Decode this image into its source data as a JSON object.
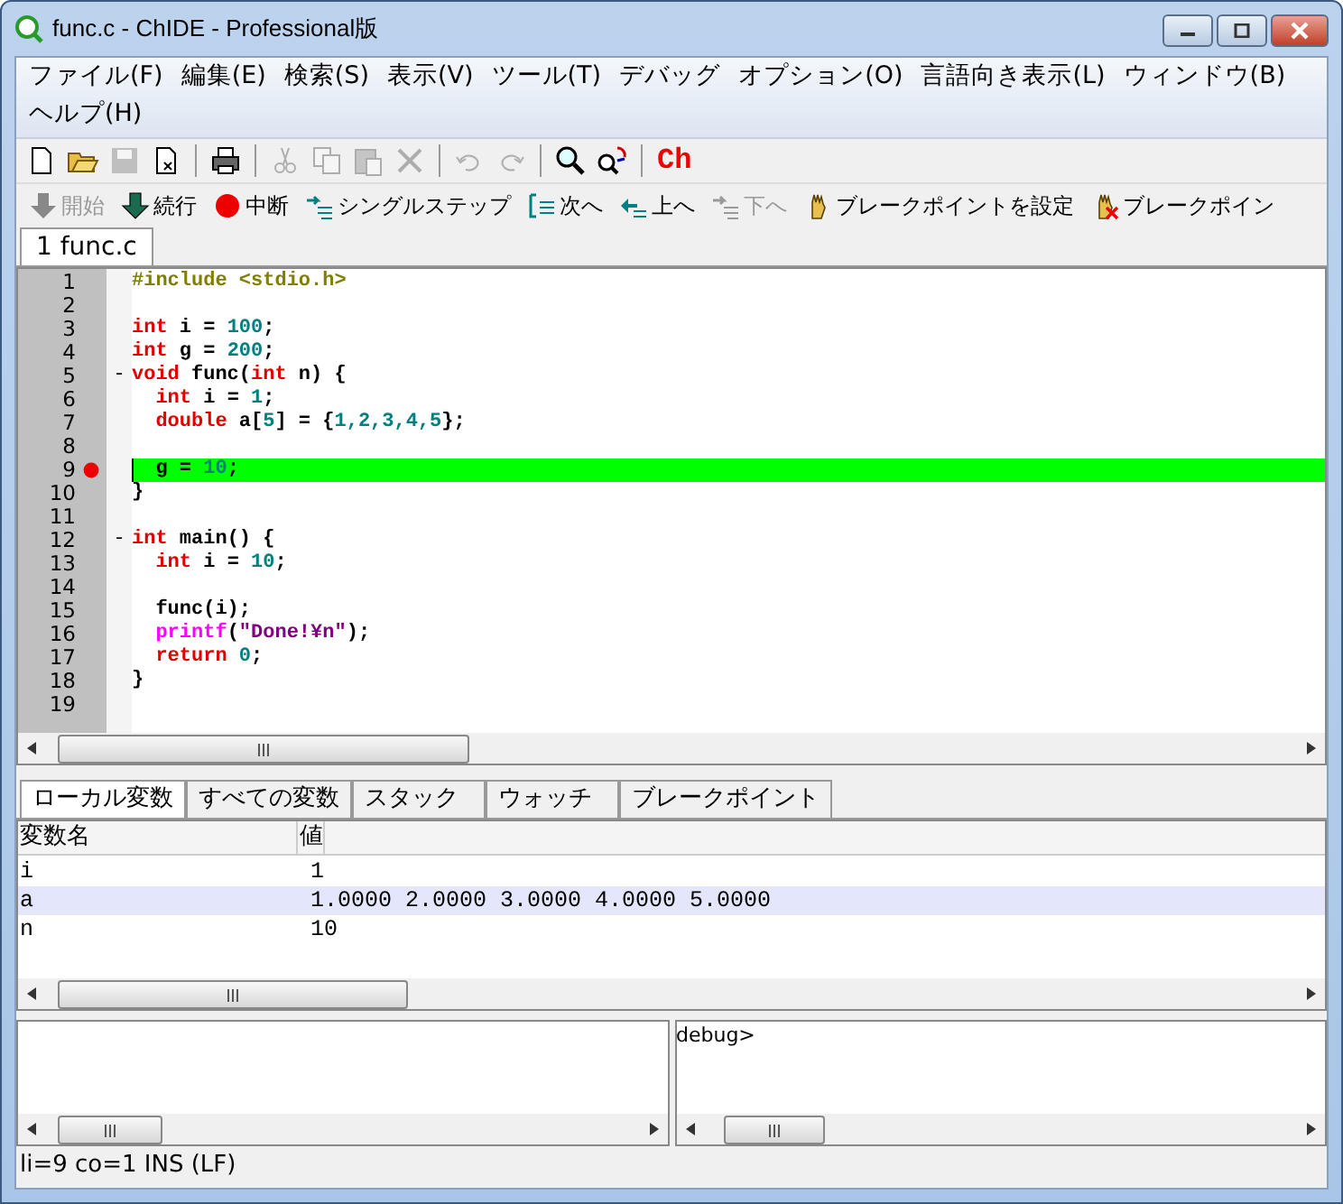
{
  "window": {
    "title": "func.c - ChIDE - Professional版"
  },
  "menu": [
    {
      "label": "ファイル(F)"
    },
    {
      "label": "編集(E)"
    },
    {
      "label": "検索(S)"
    },
    {
      "label": "表示(V)"
    },
    {
      "label": "ツール(T)"
    },
    {
      "label": "デバッグ"
    },
    {
      "label": "オプション(O)"
    },
    {
      "label": "言語向き表示(L)"
    },
    {
      "label": "ウィンドウ(B)"
    },
    {
      "label": "ヘルプ(H)"
    }
  ],
  "toolbar": [
    {
      "kind": "new",
      "disabled": false
    },
    {
      "kind": "open",
      "disabled": false
    },
    {
      "kind": "save",
      "disabled": true
    },
    {
      "kind": "close",
      "disabled": false
    },
    {
      "kind": "separator"
    },
    {
      "kind": "print",
      "disabled": false
    },
    {
      "kind": "separator"
    },
    {
      "kind": "cut",
      "disabled": true
    },
    {
      "kind": "copy",
      "disabled": true
    },
    {
      "kind": "paste",
      "disabled": true
    },
    {
      "kind": "delete",
      "disabled": true
    },
    {
      "kind": "separator"
    },
    {
      "kind": "undo",
      "disabled": true
    },
    {
      "kind": "redo",
      "disabled": true
    },
    {
      "kind": "separator"
    },
    {
      "kind": "find",
      "disabled": false
    },
    {
      "kind": "replace",
      "disabled": false
    },
    {
      "kind": "separator"
    },
    {
      "kind": "ch",
      "label": "Ch",
      "disabled": false
    }
  ],
  "debug_toolbar": [
    {
      "kind": "start",
      "label": "開始",
      "disabled": true
    },
    {
      "kind": "continue",
      "label": "続行",
      "disabled": false
    },
    {
      "kind": "break",
      "label": "中断",
      "disabled": false
    },
    {
      "kind": "step",
      "label": "シングルステップ",
      "disabled": false
    },
    {
      "kind": "next",
      "label": "次へ",
      "disabled": false
    },
    {
      "kind": "up",
      "label": "上へ",
      "disabled": false
    },
    {
      "kind": "down",
      "label": "下へ",
      "disabled": true
    },
    {
      "kind": "set_bp",
      "label": "ブレークポイントを設定",
      "disabled": false
    },
    {
      "kind": "clear_bp",
      "label": "ブレークポイン",
      "disabled": false
    }
  ],
  "file_tabs": [
    {
      "label": "1 func.c",
      "selected": true
    }
  ],
  "editor": {
    "lines": [
      {
        "number": "1",
        "breakpoint": false,
        "current": false,
        "tokens": [
          {
            "t": "#include <stdio.h>",
            "kind": "pre"
          }
        ]
      },
      {
        "number": "2",
        "breakpoint": false,
        "current": false
      },
      {
        "number": "3",
        "breakpoint": false,
        "current": false,
        "tokens": [
          {
            "t": "int",
            "kind": "kw"
          },
          {
            "t": " i = ",
            "kind": "id"
          },
          {
            "t": "100",
            "kind": "num"
          },
          {
            "t": ";",
            "kind": "id"
          }
        ]
      },
      {
        "number": "4",
        "breakpoint": false,
        "current": false,
        "tokens": [
          {
            "t": "int",
            "kind": "kw"
          },
          {
            "t": " g = ",
            "kind": "id"
          },
          {
            "t": "200",
            "kind": "num"
          },
          {
            "t": ";",
            "kind": "id"
          }
        ]
      },
      {
        "number": "5",
        "fold": "-",
        "breakpoint": false,
        "current": false,
        "tokens": [
          {
            "t": "void",
            "kind": "kw"
          },
          {
            "t": " func(",
            "kind": "id"
          },
          {
            "t": "int",
            "kind": "kw"
          },
          {
            "t": " n) {",
            "kind": "id"
          }
        ]
      },
      {
        "number": "6",
        "breakpoint": false,
        "current": false,
        "tokens": [
          {
            "t": "  int",
            "kind": "kw"
          },
          {
            "t": " i = ",
            "kind": "id"
          },
          {
            "t": "1",
            "kind": "num"
          },
          {
            "t": ";",
            "kind": "id"
          }
        ]
      },
      {
        "number": "7",
        "breakpoint": false,
        "current": false,
        "tokens": [
          {
            "t": "  double",
            "kind": "kw"
          },
          {
            "t": " a[",
            "kind": "id"
          },
          {
            "t": "5",
            "kind": "num"
          },
          {
            "t": "] = {",
            "kind": "id"
          },
          {
            "t": "1,2,3,4,5",
            "kind": "num"
          },
          {
            "t": "};",
            "kind": "id"
          }
        ]
      },
      {
        "number": "8",
        "breakpoint": false,
        "current": false
      },
      {
        "number": "9",
        "breakpoint": true,
        "current": true,
        "tokens": [
          {
            "t": "  g = ",
            "kind": "id"
          },
          {
            "t": "10",
            "kind": "num"
          },
          {
            "t": ";",
            "kind": "id"
          }
        ]
      },
      {
        "number": "10",
        "breakpoint": false,
        "current": false,
        "tokens": [
          {
            "t": "}",
            "kind": "id"
          }
        ]
      },
      {
        "number": "11",
        "breakpoint": false,
        "current": false
      },
      {
        "number": "12",
        "fold": "-",
        "breakpoint": false,
        "current": false,
        "tokens": [
          {
            "t": "int",
            "kind": "kw"
          },
          {
            "t": " main() {",
            "kind": "id"
          }
        ]
      },
      {
        "number": "13",
        "breakpoint": false,
        "current": false,
        "tokens": [
          {
            "t": "  int",
            "kind": "kw"
          },
          {
            "t": " i = ",
            "kind": "id"
          },
          {
            "t": "10",
            "kind": "num"
          },
          {
            "t": ";",
            "kind": "id"
          }
        ]
      },
      {
        "number": "14",
        "breakpoint": false,
        "current": false
      },
      {
        "number": "15",
        "breakpoint": false,
        "current": false,
        "tokens": [
          {
            "t": "  func(i);",
            "kind": "id"
          }
        ]
      },
      {
        "number": "16",
        "breakpoint": false,
        "current": false,
        "tokens": [
          {
            "t": "  printf",
            "kind": "fn"
          },
          {
            "t": "(",
            "kind": "id"
          },
          {
            "t": "\"Done!¥n\"",
            "kind": "str"
          },
          {
            "t": ");",
            "kind": "id"
          }
        ]
      },
      {
        "number": "17",
        "breakpoint": false,
        "current": false,
        "tokens": [
          {
            "t": "  return",
            "kind": "kw"
          },
          {
            "t": " 0",
            "kind": "num"
          },
          {
            "t": ";",
            "kind": "id"
          }
        ]
      },
      {
        "number": "18",
        "breakpoint": false,
        "current": false,
        "tokens": [
          {
            "t": "}",
            "kind": "id"
          }
        ]
      },
      {
        "number": "19",
        "breakpoint": false,
        "current": false
      }
    ]
  },
  "variables": {
    "tabs": [
      {
        "label": "ローカル変数",
        "selected": true
      },
      {
        "label": "すべての変数",
        "selected": false
      },
      {
        "label": "スタック",
        "selected": false
      },
      {
        "label": "ウォッチ",
        "selected": false
      },
      {
        "label": "ブレークポイント",
        "selected": false
      }
    ],
    "columns": [
      "変数名",
      "値"
    ],
    "rows": [
      {
        "name": "i",
        "value": "1",
        "selected": false
      },
      {
        "name": "a",
        "value": "1.0000 2.0000 3.0000 4.0000 5.0000",
        "selected": true
      },
      {
        "name": "n",
        "value": "10",
        "selected": false
      }
    ]
  },
  "debug_console": {
    "text": "debug>"
  },
  "status_bar": {
    "text": "li=9 co=1 INS (LF)"
  }
}
